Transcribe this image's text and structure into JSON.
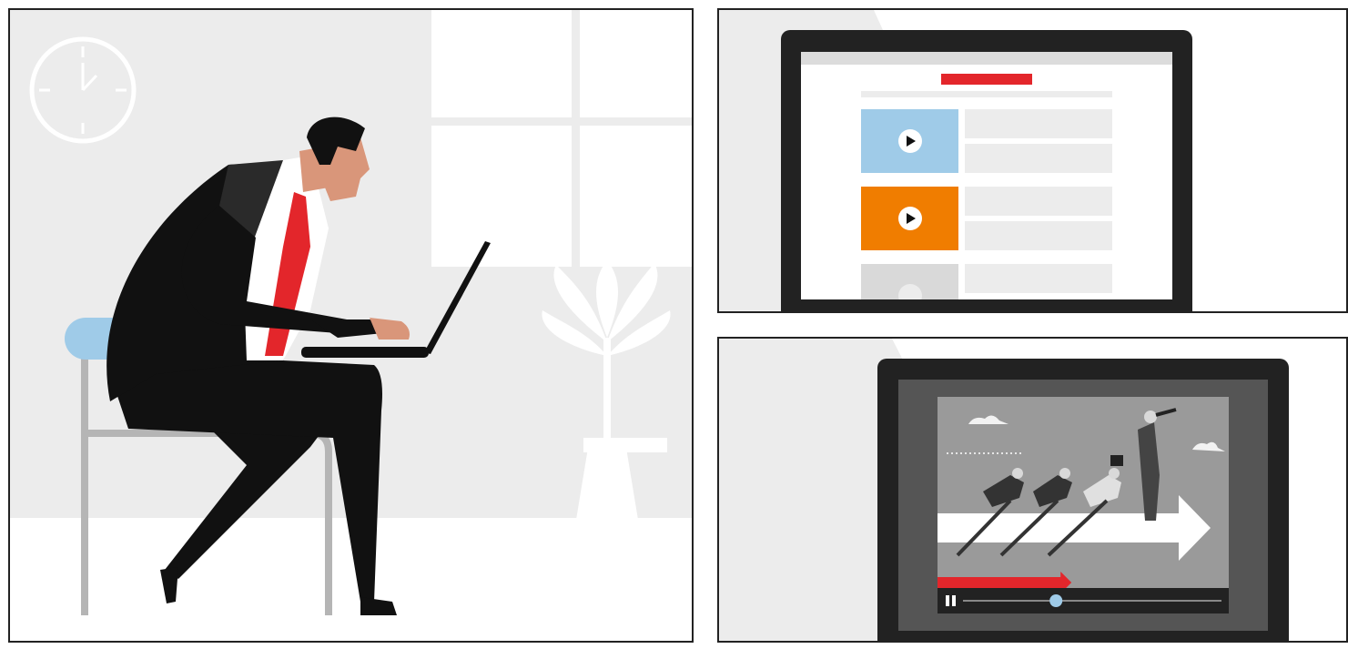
{
  "colors": {
    "accent_red": "#e3262b",
    "thumb_blue": "#9fcbe8",
    "thumb_orange": "#f07d00",
    "thumb_gray": "#d9d9d9",
    "suit_black": "#111111",
    "skin": "#d9967a",
    "seat_blue": "#9fcbe8",
    "wall_gray": "#ececec",
    "laptop_frame": "#222222",
    "progress_knob": "#9fcbe8"
  },
  "scene_left": {
    "icons": [
      "clock-icon",
      "plant-icon",
      "laptop-icon",
      "chair-icon"
    ]
  },
  "scene_top_right": {
    "video_list": [
      {
        "thumb": "blue",
        "icon": "play-icon"
      },
      {
        "thumb": "orange",
        "icon": "play-icon"
      },
      {
        "thumb": "gray",
        "icon": "play-icon"
      }
    ]
  },
  "scene_bottom_right": {
    "player": {
      "state_icon": "pause-icon",
      "progress": 0.36,
      "buffered": 0.46
    }
  }
}
